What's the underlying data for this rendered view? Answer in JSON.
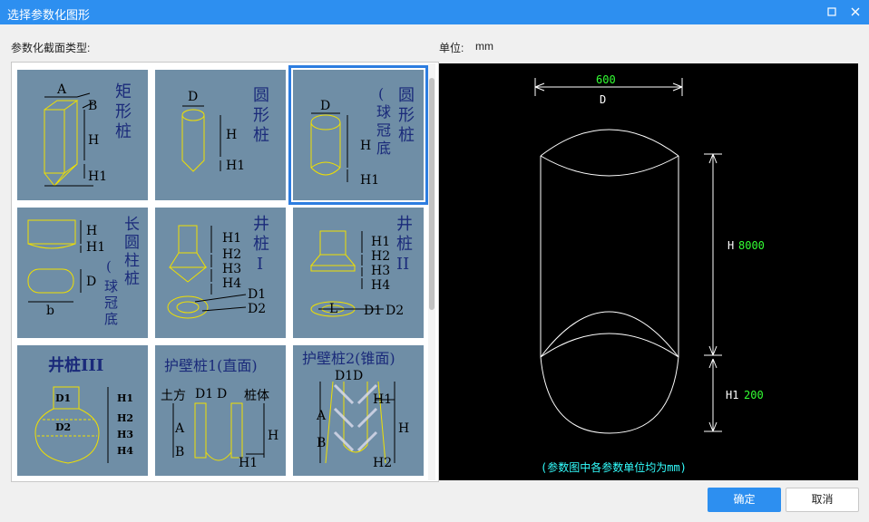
{
  "window": {
    "title": "选择参数化图形",
    "maximize_icon": "maximize-icon",
    "close_icon": "close-icon"
  },
  "left": {
    "label": "参数化截面类型:"
  },
  "unit": {
    "label": "单位:",
    "value": "mm"
  },
  "tiles": [
    {
      "name": "矩形桩",
      "labels": [
        "A",
        "B",
        "H",
        "H1"
      ]
    },
    {
      "name": "圆形桩",
      "labels": [
        "D",
        "H",
        "H1"
      ]
    },
    {
      "name": "圆形桩（球冠底）",
      "labels": [
        "D",
        "H",
        "H1"
      ]
    },
    {
      "name": "长圆柱桩（球冠底）",
      "labels": [
        "H",
        "H1",
        "D",
        "b"
      ]
    },
    {
      "name": "井桩I",
      "labels": [
        "H1",
        "H2",
        "H3",
        "H4",
        "D1",
        "D2"
      ]
    },
    {
      "name": "井桩II",
      "labels": [
        "H1",
        "H2",
        "H3",
        "H4",
        "L",
        "D1",
        "D2"
      ]
    },
    {
      "name": "井桩III",
      "labels": [
        "D1",
        "D2",
        "H1",
        "H2",
        "H3",
        "H4"
      ]
    },
    {
      "name": "护壁桩1(直面)",
      "labels": [
        "土方",
        "D1",
        "D",
        "桩体",
        "A",
        "B",
        "H",
        "H1"
      ]
    },
    {
      "name": "护壁桩2(锥面)",
      "labels": [
        "D1",
        "D",
        "A",
        "B",
        "H",
        "H1",
        "H2"
      ]
    }
  ],
  "preview": {
    "d_value": "600",
    "d_label": "D",
    "h_label": "H",
    "h_value": "8000",
    "h1_label": "H1",
    "h1_value": "200",
    "note": "(参数图中各参数单位均为mm)",
    "line_color": "#ffffff",
    "value_color": "#33ff33",
    "note_color": "#33ffff"
  },
  "buttons": {
    "ok": "确定",
    "cancel": "取消"
  },
  "colors": {
    "titlebar": "#2d8ff0",
    "tile_bg": "#6f8ea6",
    "selected_border": "#2d7de0"
  }
}
